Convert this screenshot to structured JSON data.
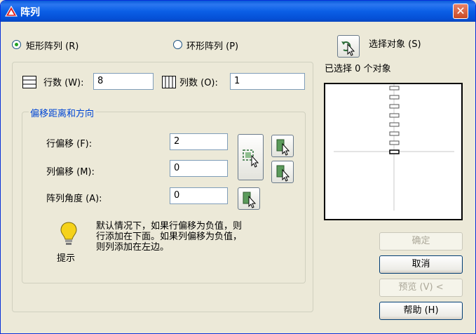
{
  "window": {
    "title": "阵列",
    "close_label": "✕"
  },
  "mode": {
    "rect_label": "矩形阵列 (R)",
    "polar_label": "环形阵列 (P)",
    "selected": "rect"
  },
  "select_objects": {
    "button_label": "选择对象 (S)",
    "status_prefix": "已选择",
    "count": "0",
    "status_suffix": "个对象"
  },
  "grid": {
    "rows_label": "行数 (W):",
    "rows_value": "8",
    "cols_label": "列数 (O):",
    "cols_value": "1"
  },
  "offset": {
    "group_title": "偏移距离和方向",
    "row_offset_label": "行偏移 (F):",
    "row_offset_value": "2",
    "col_offset_label": "列偏移 (M):",
    "col_offset_value": "0",
    "angle_label": "阵列角度 (A):",
    "angle_value": "0"
  },
  "tip": {
    "caption": "提示",
    "line1": "默认情况下，如果行偏移为负值，则",
    "line2": "行添加在下面。如果列偏移为负值，",
    "line3": "则列添加在左边。"
  },
  "buttons": {
    "ok": "确定",
    "cancel": "取消",
    "preview": "预览 (V) <",
    "help": "帮助 (H)"
  },
  "colors": {
    "titlebar": "#0b5fe6",
    "radio_dot": "#21a121",
    "group_title": "#0046d5",
    "tip_bulb": "#f5d21a"
  }
}
